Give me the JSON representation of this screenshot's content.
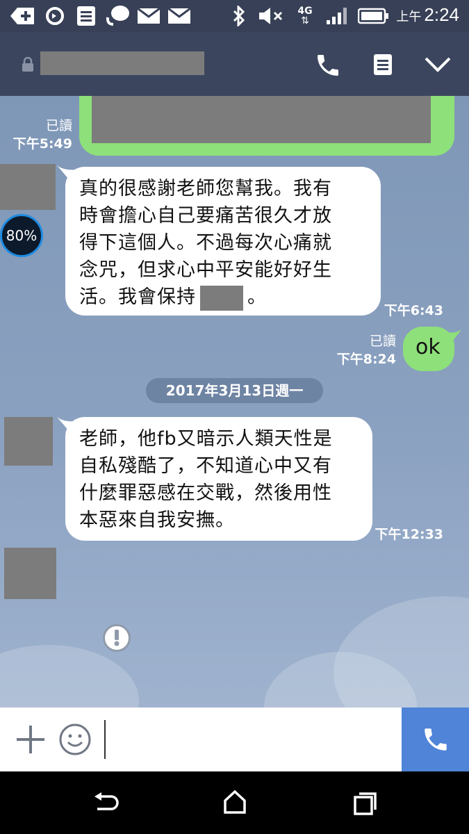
{
  "status_bar": {
    "time_period": "上午",
    "time": "2:24",
    "network": "4G",
    "icons": [
      "add-notification-icon",
      "sync-icon",
      "document-icon",
      "chat-bubble-icon",
      "mail-icon",
      "mail-icon",
      "bluetooth-icon",
      "mute-icon",
      "network-4g-icon",
      "signal-icon",
      "battery-icon"
    ]
  },
  "header": {
    "lock_icon": "lock-icon",
    "call_icon": "phone-icon",
    "notes_icon": "notes-icon",
    "menu_icon": "chevron-down-icon"
  },
  "messages": [
    {
      "id": "m1",
      "side": "out",
      "read_label": "已讀",
      "time": "下午5:49",
      "redacted": true
    },
    {
      "id": "m2",
      "side": "in",
      "lines": [
        "真的很感謝老師您幫我。我有",
        "時會擔心自己要痛苦很久才放",
        "得下這個人。不過每次心痛就",
        "念咒，但求心中平安能好好生"
      ],
      "last_line_prefix": "活。我會保持",
      "last_line_suffix": "。",
      "time": "下午6:43"
    },
    {
      "id": "m3",
      "side": "out",
      "read_label": "已讀",
      "time": "下午8:24",
      "text": "ok"
    },
    {
      "id": "m4",
      "side": "in",
      "lines": [
        "老師，他fb又暗示人類天性是",
        "自私殘酷了，不知道心中又有",
        "什麼罪惡感在交戰，然後用性",
        "本惡來自我安撫。"
      ],
      "time": "下午12:33"
    }
  ],
  "date_separator": "2017年3月13日週一",
  "overlay_badge": "80%",
  "input": {
    "placeholder": ""
  },
  "colors": {
    "statusbar": "#374056",
    "appbar": "#3b465e",
    "out_bubble": "#8ee07a",
    "call_button": "#4f84d8"
  }
}
